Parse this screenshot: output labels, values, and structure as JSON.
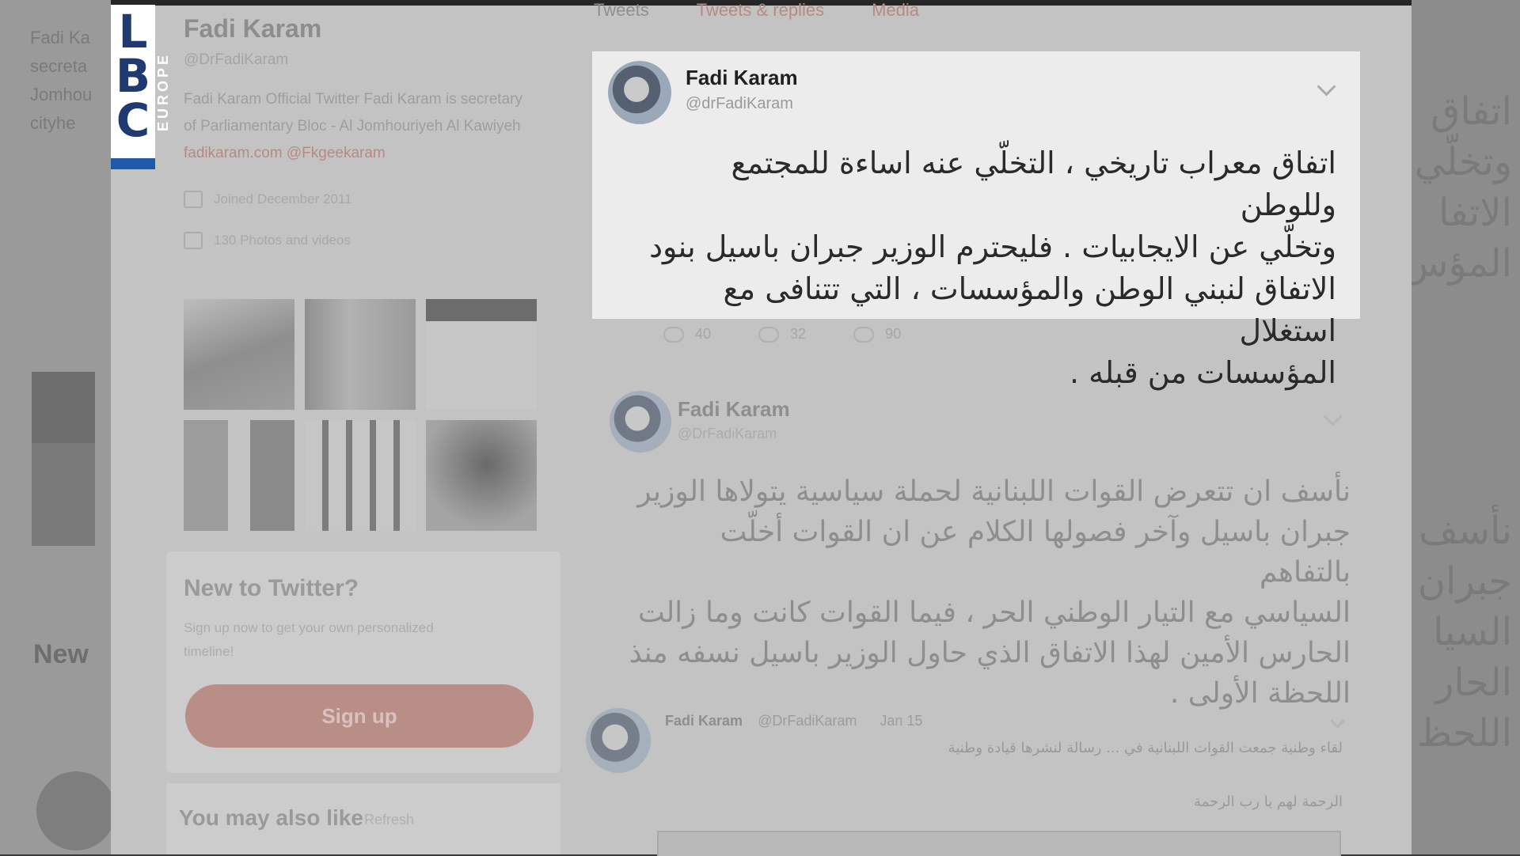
{
  "logo": {
    "letters": [
      "L",
      "B",
      "C"
    ],
    "sub": "EUROPE",
    "colors": {
      "letters": "#1f3a70",
      "stripe": "#1e5aa8"
    }
  },
  "profile": {
    "name": "Fadi Karam",
    "handle": "@DrFadiKaram",
    "bio": "Fadi Karam Official Twitter Fadi Karam is secretary of Parliamentary Bloc - Al Jomhouriyeh Al Kawiyeh",
    "bio_link": "fadikaram.com @Fkgeekaram",
    "joined": "Joined December 2011",
    "photos_label": "130 Photos and videos",
    "icons": [
      "calendar-icon",
      "photo-icon"
    ]
  },
  "signup": {
    "title": "New to Twitter?",
    "subtitle": "Sign up now to get your own personalized timeline!",
    "button": "Sign up"
  },
  "you_may_also_like": {
    "title": "You may also like",
    "refresh": "Refresh"
  },
  "tabs": [
    "Tweets",
    "Tweets & replies",
    "Media"
  ],
  "tweets": [
    {
      "name": "Fadi Karam",
      "handle": "@drFadiKaram",
      "lines": [
        "اتفاق معراب تاريخي ، التخلّي عنه اساءة للمجتمع وللوطن",
        "وتخلّي عن الايجابيات . فليحترم الوزير جبران باسيل بنود",
        "الاتفاق لنبني الوطن والمؤسسات ، التي تتنافى مع استغلال",
        "المؤسسات من قبله ."
      ],
      "actions": [
        {
          "icon": "reply-icon",
          "count": "40"
        },
        {
          "icon": "retweet-icon",
          "count": "32"
        },
        {
          "icon": "like-icon",
          "count": "90"
        }
      ]
    },
    {
      "name": "Fadi Karam",
      "handle": "@DrFadiKaram",
      "lines": [
        "نأسف ان تتعرض القوات اللبنانية لحملة سياسية يتولاها الوزير",
        "جبران باسيل وآخر فصولها الكلام عن ان القوات أخلّت بالتفاهم",
        "السياسي مع التيار الوطني الحر ، فيما القوات كانت وما زالت",
        "الحارس الأمين لهذا الاتفاق الذي حاول الوزير باسيل نسفه منذ",
        "اللحظة الأولى ."
      ]
    },
    {
      "name": "Fadi Karam",
      "handle": "@DrFadiKaram",
      "time": "Jan 15",
      "text_a": "لقاء وطنية جمعت القوات اللبنانية في ... رسالة لنشرها قيادة وطنية",
      "text_b": "الرحمة لهم يا رب الرحمة"
    }
  ]
}
